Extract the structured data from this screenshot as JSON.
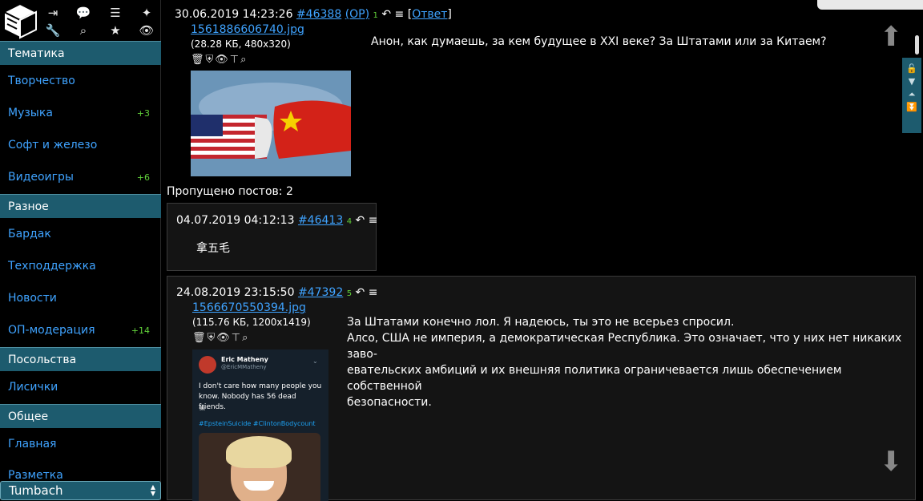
{
  "sidebar": {
    "sections": [
      {
        "title": "Тематика",
        "items": [
          {
            "label": "Творчество",
            "count": ""
          },
          {
            "label": "Музыка",
            "count": "+3"
          },
          {
            "label": "Софт и железо",
            "count": ""
          },
          {
            "label": "Видеоигры",
            "count": "+6"
          }
        ]
      },
      {
        "title": "Разное",
        "items": [
          {
            "label": "Бардак",
            "count": ""
          },
          {
            "label": "Техподдержка",
            "count": ""
          },
          {
            "label": "Новости",
            "count": ""
          },
          {
            "label": "ОП-модерация",
            "count": "+14"
          }
        ]
      },
      {
        "title": "Посольства",
        "items": [
          {
            "label": "Лисички",
            "count": ""
          }
        ]
      },
      {
        "title": "Общее",
        "items": [
          {
            "label": "Главная",
            "count": ""
          },
          {
            "label": "Разметка",
            "count": ""
          }
        ]
      }
    ],
    "board_select": "Tumbach",
    "tool_icons": [
      "logout-icon",
      "chat-icon",
      "list-icon",
      "magic-wand-icon",
      "wrench-icon",
      "search-icon",
      "star-icon",
      "eye-icon"
    ]
  },
  "op_post": {
    "datetime": "30.06.2019 14:23:26",
    "number": "#46388",
    "op_label": "(OP)",
    "index": "1",
    "reply_link": "Ответ",
    "file_name": "1561886606740.jpg",
    "file_meta": "(28.28 КБ, 480x320)",
    "text": "Анон, как думаешь, за кем будущее в XXI веке? За Штатами или за Китаем?"
  },
  "skipped_posts": "Пропущено постов: 2",
  "reply1": {
    "datetime": "04.07.2019 04:12:13",
    "number": "#46413",
    "index": "4",
    "text": "拿五毛"
  },
  "reply2": {
    "datetime": "24.08.2019 23:15:50",
    "number": "#47392",
    "index": "5",
    "file_name": "1566670550394.jpg",
    "file_meta": "(115.76 КБ, 1200x1419)",
    "text_lines": [
      "За Штатами конечно лол. Я надеюсь, ты это не всерьез спросил.",
      "Алсо, США не империя, а демократическая Республика. Это означает, что у них нет никаких заво-",
      "евательских амбиций и их внешняя политика ограничевается лишь обеспечением собственной",
      "безопасности."
    ],
    "tweet": {
      "name": "Eric Matheny",
      "handle": "@EricMMatheny",
      "text": "I don't care how many people you know. Nobody has 56 dead friends.",
      "hashtags": "#EpsteinSuicide #ClintonBodycount"
    }
  },
  "colors": {
    "accent": "#1d5b6e",
    "link": "#3fa3ff",
    "count": "#62d33a",
    "background": "#000000"
  }
}
